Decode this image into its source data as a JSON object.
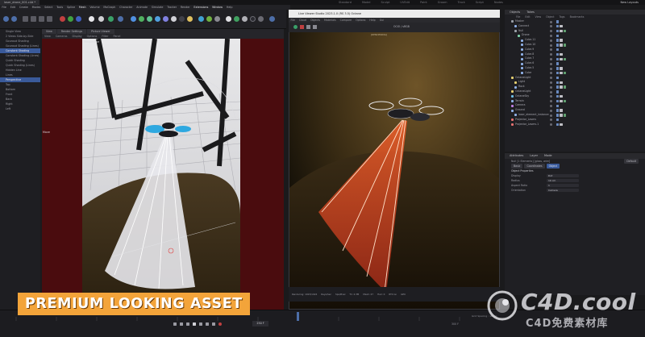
{
  "window": {
    "tab_title": "laser_drone_001.c4d *",
    "workspace_tabs": [
      "Standard",
      "Model",
      "Sculpt",
      "UVEdit",
      "Paint",
      "Groom",
      "Track",
      "Script",
      "Nodes"
    ],
    "layout_label": "New Layouts"
  },
  "menubar": {
    "items": [
      "File",
      "Edit",
      "Create",
      "Modes",
      "Select",
      "Tools",
      "Spline",
      "Mesh",
      "Volume",
      "MoGraph",
      "Character",
      "Animate",
      "Simulate",
      "Tracker",
      "Render",
      "Extensions",
      "Window",
      "Help"
    ],
    "highlighted": [
      "Mesh",
      "Extensions",
      "Window"
    ]
  },
  "modes_panel": {
    "items": [
      "Single View",
      "2 Views Side-by-Side",
      "Gouraud Shading",
      "Gouraud Shading (Lines)",
      "Constant Shading",
      "Constant Shading (Lines)",
      "Quick Shading",
      "Quick Shading (Lines)",
      "Hidden Line",
      "Lines",
      "Perspective",
      "Top",
      "Bottom",
      "Front",
      "Back",
      "Right",
      "Left"
    ],
    "selected": [
      "Constant Shading",
      "Perspective"
    ]
  },
  "viewport": {
    "tabs": [
      "View",
      "Render Settings",
      "Picture Viewer"
    ],
    "menu": [
      "View",
      "Cameras",
      "Display",
      "Options",
      "Filter",
      "Panel"
    ],
    "label": "Perspective",
    "side_label": "Move"
  },
  "render_window": {
    "title": "Live Viewer Studio 2023.1.0 (RS 3.5) Octane",
    "menu": [
      "File",
      "Cloud",
      "Objects",
      "Materials",
      "Compare",
      "Options",
      "Help",
      "Gui"
    ],
    "color_label": "OCIO / sRGB",
    "region_label": "[RENDERING]",
    "status": [
      "Rendering: 1023/1024",
      "Rays/Sec",
      "Sps/Pixel",
      "Tri: 2.3M",
      "Mesh: 27",
      "Hair: 0",
      "RTX:on",
      "GPU"
    ]
  },
  "object_manager": {
    "header": [
      "Objects",
      "Takes"
    ],
    "menu": [
      "File",
      "Edit",
      "View",
      "Object",
      "Tags",
      "Bookmarks"
    ],
    "objects": [
      {
        "name": "Master",
        "indent": 0,
        "color": "#9aa0a8"
      },
      {
        "name": "Connect",
        "indent": 1,
        "color": "#8fb0e6"
      },
      {
        "name": "Null",
        "indent": 1,
        "color": "#9aa0a8"
      },
      {
        "name": "Drone",
        "indent": 2,
        "color": "#7fd0a8"
      },
      {
        "name": "Cube.11",
        "indent": 3,
        "color": "#8fb0e6"
      },
      {
        "name": "Cube.10",
        "indent": 3,
        "color": "#8fb0e6"
      },
      {
        "name": "Cube.9",
        "indent": 3,
        "color": "#8fb0e6"
      },
      {
        "name": "Cube.8",
        "indent": 3,
        "color": "#8fb0e6"
      },
      {
        "name": "Cube.7",
        "indent": 3,
        "color": "#8fb0e6"
      },
      {
        "name": "Cube.6",
        "indent": 3,
        "color": "#8fb0e6"
      },
      {
        "name": "Cube.5",
        "indent": 3,
        "color": "#8fb0e6"
      },
      {
        "name": "Cube",
        "indent": 3,
        "color": "#8fb0e6"
      },
      {
        "name": "OctaneLight",
        "indent": 0,
        "color": "#e6d070"
      },
      {
        "name": "Light",
        "indent": 1,
        "color": "#e6d070"
      },
      {
        "name": "Rock",
        "indent": 1,
        "color": "#8fb0e6"
      },
      {
        "name": "OctaneLight",
        "indent": 0,
        "color": "#e6d070"
      },
      {
        "name": "OctaneSky",
        "indent": 0,
        "color": "#70c0e6"
      },
      {
        "name": "Terrain",
        "indent": 0,
        "color": "#8fb0e6"
      },
      {
        "name": "Camera",
        "indent": 0,
        "color": "#c080e6"
      },
      {
        "name": "Ground",
        "indent": 0,
        "color": "#8fb0e6"
      },
      {
        "name": "laser_element_instance",
        "indent": 1,
        "color": "#8fb0e6"
      },
      {
        "name": "Projector_Lasers",
        "indent": 0,
        "color": "#e67070"
      },
      {
        "name": "Projector_Lasers.1",
        "indent": 0,
        "color": "#e67070"
      }
    ]
  },
  "attributes": {
    "header": [
      "Attributes",
      "Layer",
      "Mode"
    ],
    "subtitle": "Null [1 Elements] [glass, wire]",
    "mode_dropdown": "Default",
    "tabs": [
      "Basic",
      "Coordinates",
      "Object"
    ],
    "active_tab": "Object",
    "section": "Object Properties",
    "fields": [
      {
        "label": "Display",
        "value": "Dot"
      },
      {
        "label": "Radius",
        "value": "10 cm"
      },
      {
        "label": "Aspect Ratio",
        "value": "1"
      },
      {
        "label": "Orientation",
        "value": "Camera"
      }
    ]
  },
  "timeline": {
    "current_frame": "250 F",
    "end_frame": "300 F",
    "snap_label": "Grid Spacing : 10 cm"
  },
  "overlay": {
    "banner": "PREMIUM LOOKING ASSET",
    "watermark_main": "C4D.cool",
    "watermark_sub": "C4D免费素材库"
  },
  "colors": {
    "banner_bg": "#f3a43a",
    "selection_blue": "#3a5a9a",
    "viewport_bg": "#4a0c0e",
    "laser_red": "#e0402a"
  }
}
